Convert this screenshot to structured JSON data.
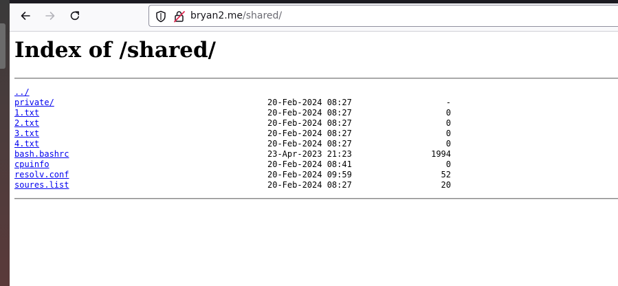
{
  "browser": {
    "url_host": "bryan2.me",
    "url_path": "/shared/",
    "icons": {
      "back": "arrow-left-icon",
      "forward": "arrow-right-icon",
      "reload": "reload-icon",
      "shield": "shield-icon",
      "lock": "lock-icon"
    }
  },
  "page": {
    "title": "Index of /shared/"
  },
  "listing": [
    {
      "name": "../",
      "date": "",
      "size": ""
    },
    {
      "name": "private/",
      "date": "20-Feb-2024 08:27",
      "size": "-"
    },
    {
      "name": "1.txt",
      "date": "20-Feb-2024 08:27",
      "size": "0"
    },
    {
      "name": "2.txt",
      "date": "20-Feb-2024 08:27",
      "size": "0"
    },
    {
      "name": "3.txt",
      "date": "20-Feb-2024 08:27",
      "size": "0"
    },
    {
      "name": "4.txt",
      "date": "20-Feb-2024 08:27",
      "size": "0"
    },
    {
      "name": "bash.bashrc",
      "date": "23-Apr-2023 21:23",
      "size": "1994"
    },
    {
      "name": "cpuinfo",
      "date": "20-Feb-2024 08:41",
      "size": "0"
    },
    {
      "name": "resolv.conf",
      "date": "20-Feb-2024 09:59",
      "size": "52"
    },
    {
      "name": "soures.list",
      "date": "20-Feb-2024 08:27",
      "size": "20"
    }
  ],
  "colors": {
    "link": "#0000ee",
    "toolbar_bg": "#f9f9fb",
    "url_path": "#6a6a72"
  }
}
